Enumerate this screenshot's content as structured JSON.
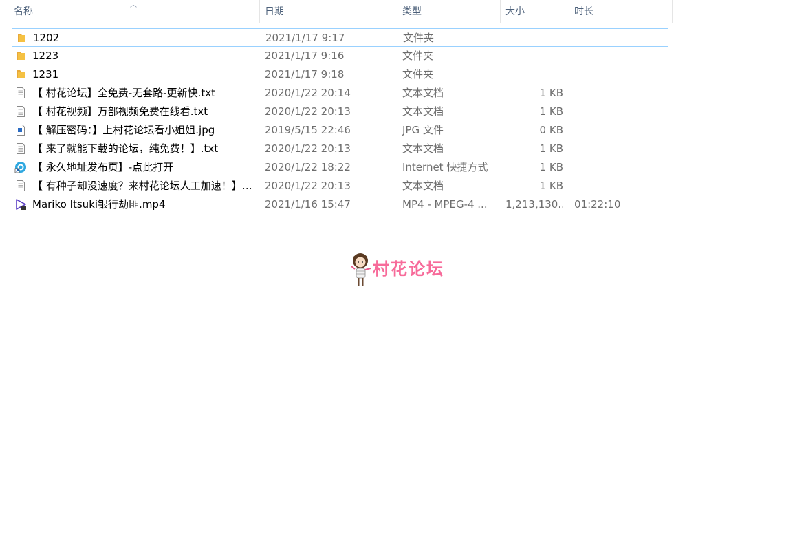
{
  "columns": {
    "name": "名称",
    "date": "日期",
    "type": "类型",
    "size": "大小",
    "length": "时长"
  },
  "files": [
    {
      "name": "1202",
      "date": "2021/1/17 9:17",
      "type": "文件夹",
      "size": "",
      "length": "",
      "icon": "folder-icon"
    },
    {
      "name": "1223",
      "date": "2021/1/17 9:16",
      "type": "文件夹",
      "size": "",
      "length": "",
      "icon": "folder-icon"
    },
    {
      "name": "1231",
      "date": "2021/1/17 9:18",
      "type": "文件夹",
      "size": "",
      "length": "",
      "icon": "folder-icon"
    },
    {
      "name": "【 村花论坛】全免费-无套路-更新快.txt",
      "date": "2020/1/22 20:14",
      "type": "文本文档",
      "size": "1 KB",
      "length": "",
      "icon": "text-file-icon"
    },
    {
      "name": "【 村花视频】万部视频免费在线看.txt",
      "date": "2020/1/22 20:13",
      "type": "文本文档",
      "size": "1 KB",
      "length": "",
      "icon": "text-file-icon"
    },
    {
      "name": "【 解压密码：】上村花论坛看小姐姐.jpg",
      "date": "2019/5/15 22:46",
      "type": "JPG 文件",
      "size": "0 KB",
      "length": "",
      "icon": "image-file-icon"
    },
    {
      "name": "【 来了就能下载的论坛，纯免费！】.txt",
      "date": "2020/1/22 20:13",
      "type": "文本文档",
      "size": "1 KB",
      "length": "",
      "icon": "text-file-icon"
    },
    {
      "name": "【 永久地址发布页】-点此打开",
      "date": "2020/1/22 18:22",
      "type": "Internet 快捷方式",
      "size": "1 KB",
      "length": "",
      "icon": "internet-shortcut-icon"
    },
    {
      "name": "【 有种子却没速度？来村花论坛人工加速！】....",
      "date": "2020/1/22 20:13",
      "type": "文本文档",
      "size": "1 KB",
      "length": "",
      "icon": "text-file-icon"
    },
    {
      "name": "Mariko Itsuki银行劫匪.mp4",
      "date": "2021/1/16 15:47",
      "type": "MP4 - MPEG-4 ...",
      "size": "1,213,130...",
      "length": "01:22:10",
      "icon": "video-file-icon"
    }
  ],
  "watermark": {
    "text": "村花论坛"
  },
  "colors": {
    "folder": "#f5c143",
    "selection_border": "#99d1ff",
    "header_text": "#4c607a",
    "watermark": "#f76b9a"
  }
}
